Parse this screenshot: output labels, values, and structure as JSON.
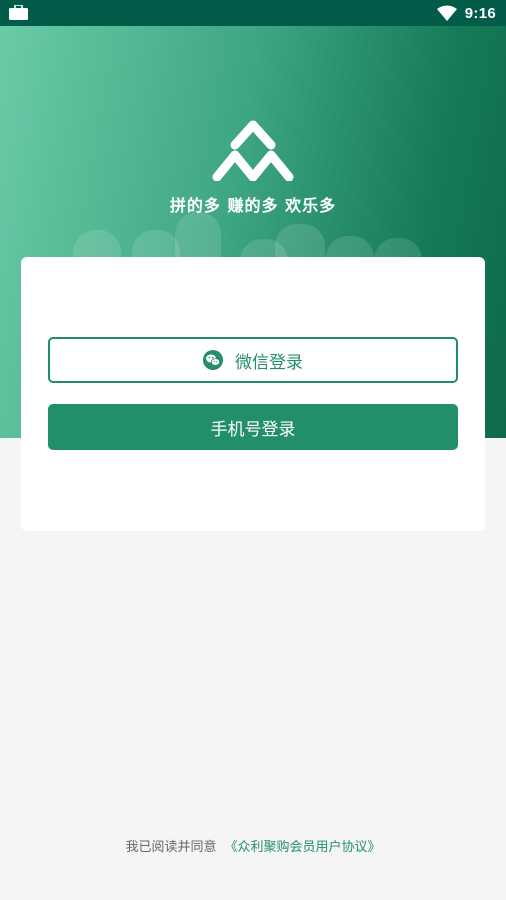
{
  "status_bar": {
    "time": "9:16"
  },
  "hero": {
    "slogan": "拼的多 赚的多 欢乐多"
  },
  "login": {
    "wechat_label": "微信登录",
    "phone_label": "手机号登录"
  },
  "agreement": {
    "prefix": "我已阅读并同意",
    "link_text": "《众利聚购会员用户协议》"
  },
  "colors": {
    "brand_green": "#238f69",
    "status_bar": "#035c4a"
  },
  "icons": [
    "briefcase-icon",
    "wifi-icon",
    "logo-icon",
    "wechat-icon"
  ]
}
